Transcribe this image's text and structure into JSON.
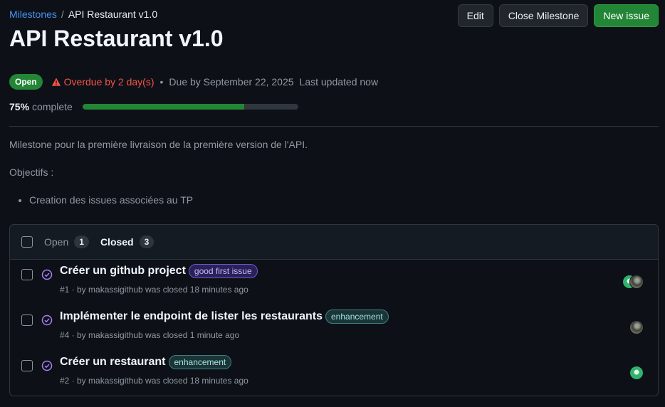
{
  "breadcrumb": {
    "parent": "Milestones",
    "separator": "/",
    "current": "API Restaurant v1.0"
  },
  "actions": {
    "edit": "Edit",
    "close": "Close Milestone",
    "new_issue": "New issue"
  },
  "title": "API Restaurant v1.0",
  "status": {
    "state": "Open",
    "overdue": "Overdue by 2 day(s)",
    "separator": "•",
    "due": "Due by September 22, 2025",
    "updated": "Last updated now"
  },
  "progress": {
    "percent_label": "75%",
    "suffix": "complete",
    "value": 0.75
  },
  "description": {
    "line1": "Milestone pour la première livraison de la première version de l'API.",
    "line2": "Objectifs :",
    "bullets": [
      "Creation des issues associées au TP"
    ]
  },
  "tabs": {
    "open_label": "Open",
    "open_count": "1",
    "closed_label": "Closed",
    "closed_count": "3"
  },
  "issues": [
    {
      "title": "Créer un github project",
      "label": "good first issue",
      "meta": "#1 · by makassigithub was closed 18 minutes ago",
      "avatars": [
        "green-identicon",
        "user-photo"
      ]
    },
    {
      "title": "Implémenter le endpoint de lister les restaurants",
      "label": "enhancement",
      "meta": "#4 · by makassigithub was closed 1 minute ago",
      "avatars": [
        "user-photo"
      ]
    },
    {
      "title": "Créer un restaurant",
      "label": "enhancement",
      "meta": "#2 · by makassigithub was closed 18 minutes ago",
      "avatars": [
        "green-identicon"
      ]
    }
  ],
  "colors": {
    "accent": "#4493f8",
    "success": "#238636",
    "danger": "#f85149",
    "closed_icon": "#ab7df8"
  }
}
